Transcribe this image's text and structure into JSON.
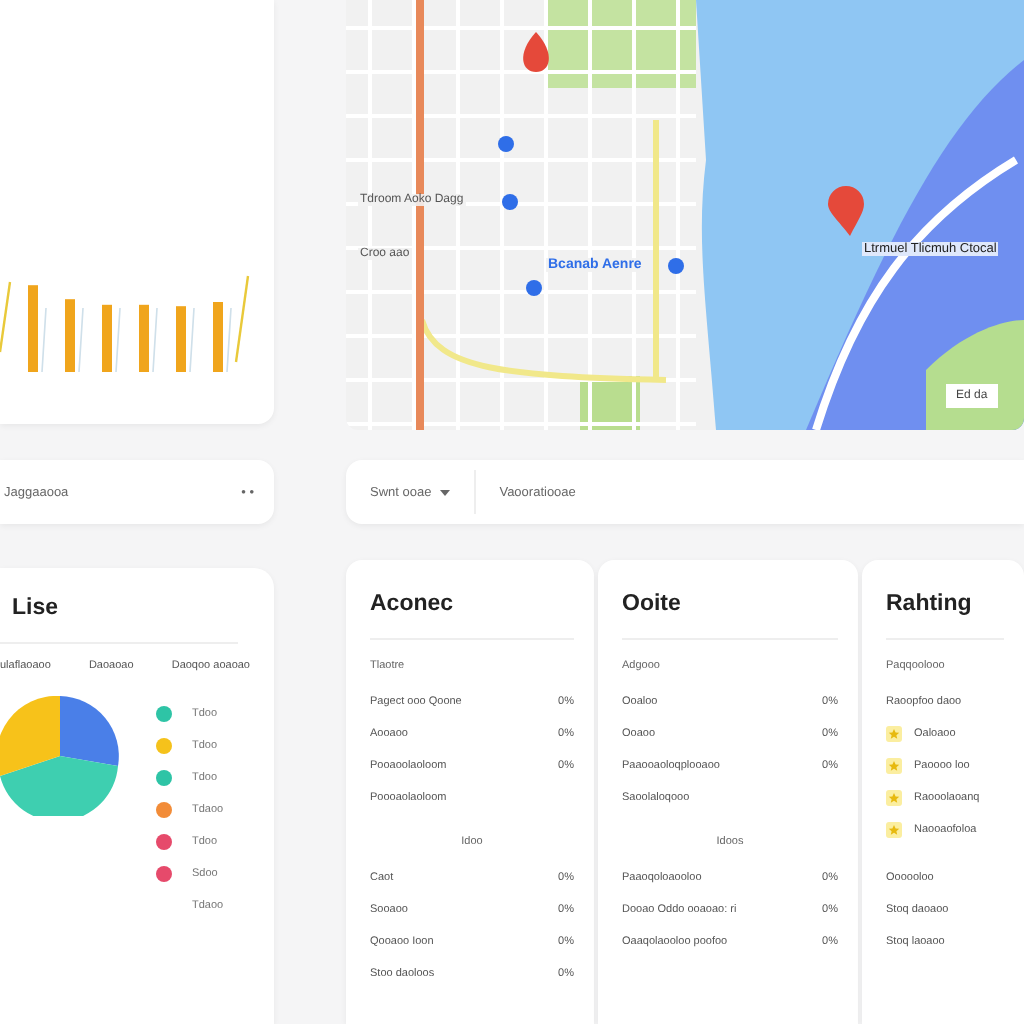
{
  "left_filter": {
    "label": "Jaggaaooa",
    "menu": "• •"
  },
  "map": {
    "labels": [
      {
        "text": "Tdroom Aoko Dagg",
        "kind": "street"
      },
      {
        "text": "Croo aao",
        "kind": "street"
      },
      {
        "text": "Bcanab Aenre",
        "kind": "place"
      },
      {
        "text": "Ltrmuel Tlicmuh Ctocal",
        "kind": "poi"
      },
      {
        "text": "Ed da",
        "kind": "badge"
      }
    ]
  },
  "filter_bar": {
    "sort": "Swnt ooae",
    "view": "Vaooratiooae"
  },
  "pie_card": {
    "title": "Lise",
    "columns": [
      "ulaflaoaoo",
      "Daoaoao",
      "Daoqoo aoaoao"
    ],
    "legend": [
      {
        "label": "Tdoo",
        "color": "#2ec4a6"
      },
      {
        "label": "Tdoo",
        "color": "#f5c21b"
      },
      {
        "label": "Tdoo",
        "color": "#2ec4a6"
      },
      {
        "label": "Tdaoo",
        "color": "#f28c38"
      },
      {
        "label": "Tdoo",
        "color": "#e64a6b"
      },
      {
        "label": "Sdoo",
        "color": "#e64a6b"
      },
      {
        "label": "Tdaoo"
      }
    ]
  },
  "panels": [
    {
      "title": "Aconec",
      "sections": [
        {
          "heading": "Tlaotre",
          "rows": [
            {
              "label": "Pagect ooo Qoone",
              "value": "0%"
            },
            {
              "label": "Aooaoo",
              "value": "0%"
            },
            {
              "label": "Pooaoolaoloom",
              "value": "0%"
            },
            {
              "label": "Poooaolaoloom",
              "value": ""
            }
          ]
        },
        {
          "heading": "Idoo",
          "rows": [
            {
              "label": "Caot",
              "value": "0%"
            },
            {
              "label": "Sooaoo",
              "value": "0%"
            },
            {
              "label": "Qooaoo Ioon",
              "value": "0%"
            },
            {
              "label": "Stoo daoloos",
              "value": "0%"
            }
          ]
        }
      ]
    },
    {
      "title": "Ooite",
      "sections": [
        {
          "heading": "Adgooo",
          "rows": [
            {
              "label": "Ooaloo",
              "value": "0%"
            },
            {
              "label": "Ooaoo",
              "value": "0%"
            },
            {
              "label": "Paaooaoloqplooaoo",
              "value": "0%"
            },
            {
              "label": "Saoolaloqooo",
              "value": ""
            }
          ]
        },
        {
          "heading": "Idoos",
          "rows": [
            {
              "label": "Paaoqoloaooloo",
              "value": "0%"
            },
            {
              "label": "Dooao Oddo ooaoao: ri",
              "value": "0%"
            },
            {
              "label": "Oaaqolaooloo poofoo",
              "value": "0%"
            }
          ]
        }
      ]
    },
    {
      "title": "Rahting",
      "sections": [
        {
          "heading": "Paqqoolooo",
          "rows": [
            {
              "label": "Raoopfoo daoo",
              "value": ""
            },
            {
              "label": "Oaloaoo",
              "value": "",
              "icon": true
            },
            {
              "label": "Paoooo loo",
              "value": "",
              "icon": true
            },
            {
              "label": "Raooolaoanq",
              "value": "",
              "icon": true
            },
            {
              "label": "Naooaofoloa",
              "value": "",
              "icon": true
            }
          ]
        },
        {
          "rows": [
            {
              "label": "Oooooloo",
              "value": ""
            },
            {
              "label": "Stoq daoaoo",
              "value": ""
            },
            {
              "label": "Stoq laoaoo",
              "value": ""
            }
          ]
        }
      ]
    }
  ]
}
